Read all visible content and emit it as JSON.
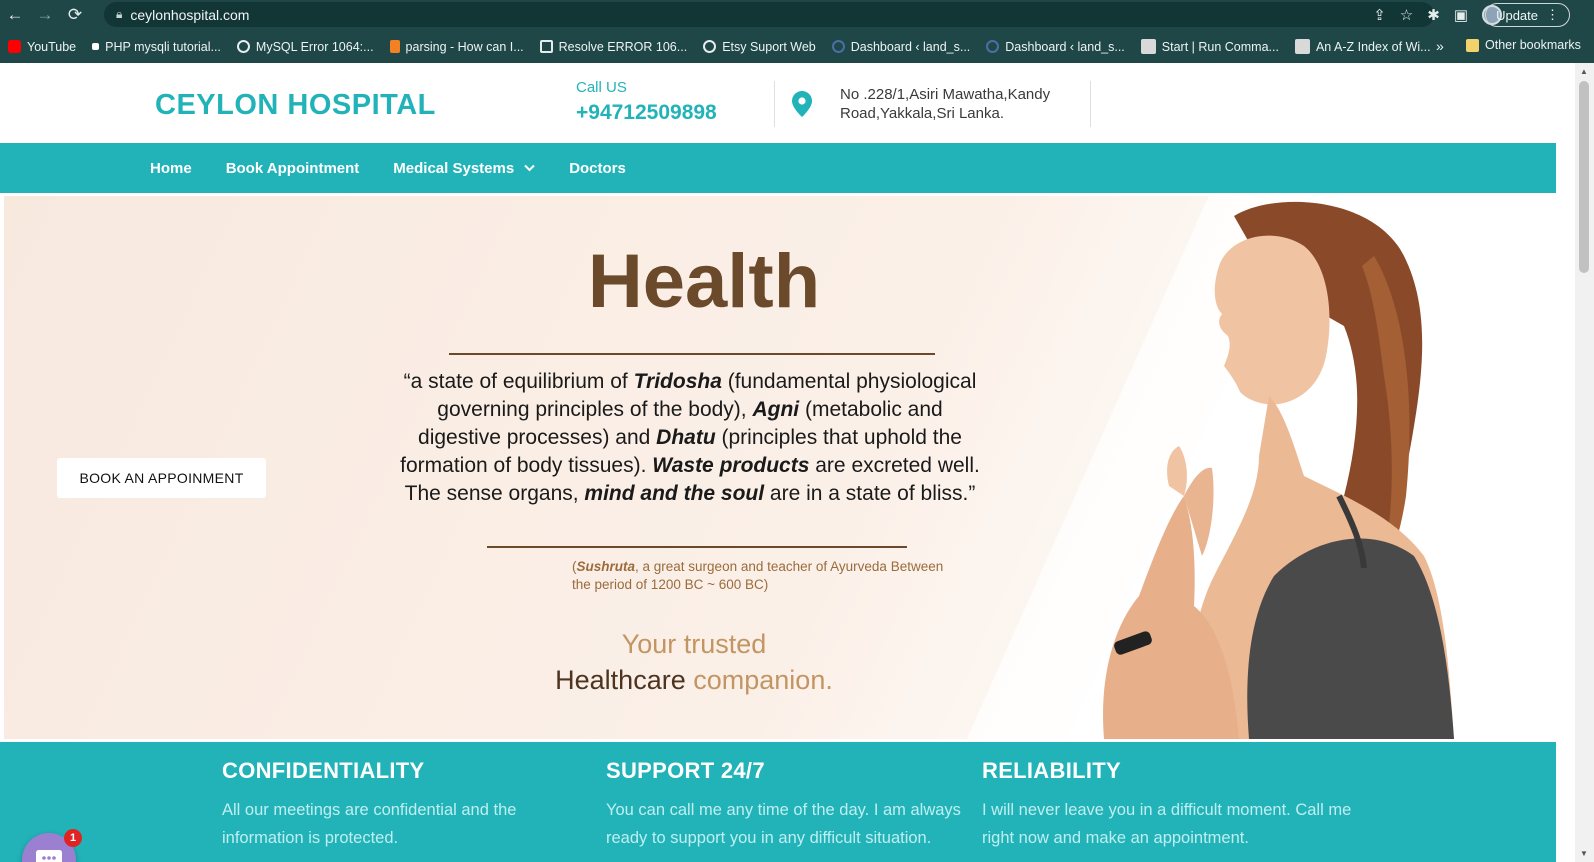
{
  "browser": {
    "url": "ceylonhospital.com",
    "update_label": "Update",
    "bookmarks": [
      {
        "label": "YouTube",
        "color": "#ff0000"
      },
      {
        "label": "PHP mysqli tutorial...",
        "color": "#ffffff"
      },
      {
        "label": "MySQL Error 1064:...",
        "color": "#e6ecec"
      },
      {
        "label": "parsing - How can I...",
        "color": "#f48024"
      },
      {
        "label": "Resolve ERROR 106...",
        "color": "#e6ecec"
      },
      {
        "label": "Etsy Suport Web",
        "color": "#e6ecec"
      },
      {
        "label": "Dashboard ‹ land_s...",
        "color": "#4a6fa5"
      },
      {
        "label": "Dashboard ‹ land_s...",
        "color": "#4a6fa5"
      },
      {
        "label": "Start | Run Comma...",
        "color": "#d9d9d9"
      },
      {
        "label": "An A-Z Index of Wi...",
        "color": "#d9d9d9"
      }
    ],
    "more_label": "»",
    "other_bookmarks": "Other bookmarks"
  },
  "header": {
    "logo": "CEYLON HOSPITAL",
    "call_label": "Call US",
    "phone": "+94712509898",
    "address": "No .228/1,Asiri Mawatha,Kandy Road,Yakkala,Sri Lanka."
  },
  "nav": {
    "home": "Home",
    "book": "Book Appointment",
    "medical": "Medical Systems",
    "doctors": "Doctors"
  },
  "hero": {
    "button": "BOOK AN APPOINMENT",
    "title": "Health",
    "quote": {
      "p1": "“a state of equilibrium of ",
      "b1": "Tridosha",
      "p2": " (fundamental physiological governing principles of the body), ",
      "b2": "Agni",
      "p3": " (metabolic and digestive processes) and ",
      "b3": "Dhatu",
      "p4": " (principles that uphold the formation of body tissues). ",
      "b4": "Waste products",
      "p5": " are excreted well.  The sense organs, ",
      "b5": "mind and the soul",
      "p6": " are in a state of bliss.”"
    },
    "attribution": {
      "open": "(",
      "name": "Sushruta",
      "rest": ", a great surgeon and teacher of Ayurveda Between the period of 1200 BC ~ 600 BC)"
    },
    "tagline": {
      "line1": "Your trusted",
      "word_dark": "Healthcare",
      "word_gold": "companion."
    }
  },
  "features": [
    {
      "title": "CONFIDENTIALITY",
      "text": "All our meetings are confidential and the information is protected."
    },
    {
      "title": "SUPPORT 24/7",
      "text": "You can call me any time of the day. I am always ready to support you in any difficult situation."
    },
    {
      "title": "RELIABILITY",
      "text": "I will never leave you in a difficult moment. Call me right now and make an appointment."
    }
  ],
  "chat": {
    "badge": "1"
  },
  "colors": {
    "brand": "#22b3b9",
    "brown": "#6b4a2b",
    "gold": "#c39562",
    "chat": "#9b7fd1"
  }
}
